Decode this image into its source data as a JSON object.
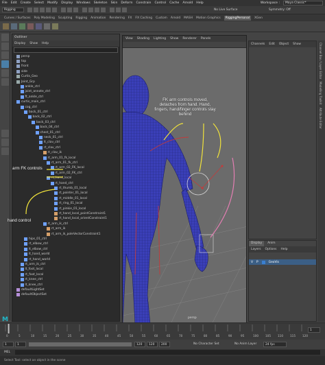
{
  "menubar": {
    "items": [
      "File",
      "Edit",
      "Create",
      "Select",
      "Modify",
      "Display",
      "Windows",
      "Skeleton",
      "Skin",
      "Deform",
      "Constrain",
      "Control",
      "Cache",
      "Arnold",
      "Help"
    ],
    "workspace_label": "Workspace :",
    "workspace_value": "Maya Classic*"
  },
  "statusline": {
    "mode": "Rigging",
    "live_surface": "No Live Surface",
    "symmetry": "Symmetry: Off"
  },
  "shelf": {
    "tabs": [
      "Curves / Surfaces",
      "Poly Modeling",
      "Sculpting",
      "Rigging",
      "Animation",
      "Rendering",
      "FX",
      "FX Caching",
      "Custom",
      "Arnold",
      "MASH",
      "Motion Graphics",
      "RiggingPersonal",
      "XGen"
    ],
    "active_tab": "RiggingPersonal"
  },
  "outliner": {
    "title": "Outliner",
    "menu": [
      "Display",
      "Show",
      "Help"
    ],
    "nodes": [
      {
        "label": "persp",
        "indent": 0,
        "type": "cam"
      },
      {
        "label": "top",
        "indent": 0,
        "type": "cam"
      },
      {
        "label": "front",
        "indent": 0,
        "type": "cam"
      },
      {
        "label": "side",
        "indent": 0,
        "type": "cam"
      },
      {
        "label": "Curtis_Geo",
        "indent": 0,
        "type": "grp"
      },
      {
        "label": "Joint_Grp",
        "indent": 0,
        "type": "grp"
      },
      {
        "label": "ankle_ctrl",
        "indent": 1,
        "type": "loc"
      },
      {
        "label": "joint_annote_ctrl",
        "indent": 1,
        "type": "loc"
      },
      {
        "label": "ft_ankle_ctrl",
        "indent": 1,
        "type": "loc"
      },
      {
        "label": "curtis_main_ctrl",
        "indent": 0,
        "type": "loc"
      },
      {
        "label": "cog_ctrl",
        "indent": 1,
        "type": "loc"
      },
      {
        "label": "back_01_ctrl",
        "indent": 2,
        "type": "loc"
      },
      {
        "label": "back_02_ctrl",
        "indent": 3,
        "type": "loc"
      },
      {
        "label": "back_03_ctrl",
        "indent": 4,
        "type": "loc"
      },
      {
        "label": "back_04_ctrl",
        "indent": 5,
        "type": "loc"
      },
      {
        "label": "chest_01_ctrl",
        "indent": 5,
        "type": "loc"
      },
      {
        "label": "neck_01_ctrl",
        "indent": 6,
        "type": "loc"
      },
      {
        "label": "lt_clav_ctrl",
        "indent": 6,
        "type": "loc"
      },
      {
        "label": "rt_clav_ctrl",
        "indent": 6,
        "type": "loc"
      },
      {
        "label": "rt_clav_ik",
        "indent": 7,
        "type": "joint"
      },
      {
        "label": "rt_arm_01_fk_local",
        "indent": 7,
        "type": "loc"
      },
      {
        "label": "rt_arm_01_fk_ctrl",
        "indent": 8,
        "type": "loc"
      },
      {
        "label": "rt_arm_02_FK_local",
        "indent": 9,
        "type": "loc"
      },
      {
        "label": "rt_arm_02_FK_ctrl",
        "indent": 9,
        "type": "loc"
      },
      {
        "label": "rt_hand_local",
        "indent": 8,
        "type": "loc"
      },
      {
        "label": "rt_hand_ctrl",
        "indent": 9,
        "type": "loc"
      },
      {
        "label": "rt_thumb_01_local",
        "indent": 10,
        "type": "loc"
      },
      {
        "label": "rt_pointer_01_local",
        "indent": 10,
        "type": "loc"
      },
      {
        "label": "rt_middle_01_local",
        "indent": 10,
        "type": "loc"
      },
      {
        "label": "rt_ring_01_local",
        "indent": 10,
        "type": "loc"
      },
      {
        "label": "rt_pinkie_01_local",
        "indent": 10,
        "type": "loc"
      },
      {
        "label": "rt_hand_local_pointConstraint1",
        "indent": 10,
        "type": "joint"
      },
      {
        "label": "rt_hand_local_orientConstraint1",
        "indent": 10,
        "type": "joint"
      },
      {
        "label": "rt_arm_ik_ctrl",
        "indent": 7,
        "type": "loc"
      },
      {
        "label": "rt_arm_ik",
        "indent": 8,
        "type": "joint"
      },
      {
        "label": "rt_arm_ik_poleVectorConstraint1",
        "indent": 8,
        "type": "joint"
      },
      {
        "label": "hips_01_ctrl",
        "indent": 2,
        "type": "loc"
      },
      {
        "label": "rt_elbow_ctrl",
        "indent": 2,
        "type": "loc"
      },
      {
        "label": "lt_elbow_ctrl",
        "indent": 2,
        "type": "loc"
      },
      {
        "label": "lt_hand_world",
        "indent": 2,
        "type": "loc"
      },
      {
        "label": "rt_hand_world",
        "indent": 2,
        "type": "loc"
      },
      {
        "label": "rt_arm_ik_ctrl",
        "indent": 1,
        "type": "loc"
      },
      {
        "label": "lt_foot_local",
        "indent": 1,
        "type": "loc"
      },
      {
        "label": "rt_foot_local",
        "indent": 1,
        "type": "loc"
      },
      {
        "label": "rt_knee_ctrl",
        "indent": 1,
        "type": "loc"
      },
      {
        "label": "lt_knee_ctrl",
        "indent": 1,
        "type": "loc"
      },
      {
        "label": "defaultLightSet",
        "indent": 0,
        "type": "set"
      },
      {
        "label": "defaultObjectSet",
        "indent": 0,
        "type": "set"
      }
    ]
  },
  "viewport": {
    "menu": [
      "View",
      "Shading",
      "Lighting",
      "Show",
      "Renderer",
      "Panels"
    ],
    "camera_label": "persp"
  },
  "channelbox": {
    "menu": [
      "Channels",
      "Edit",
      "Object",
      "Show"
    ]
  },
  "display_panel": {
    "tabs": [
      "Display",
      "Anim"
    ],
    "menu": [
      "Layers",
      "Options",
      "Help"
    ],
    "layer_v": "V",
    "layer_p": "P",
    "layer_name": "GeoVis"
  },
  "side_tabs": [
    "Channel Box / Layer Editor",
    "Modelling Toolkit",
    "Attribute Editor"
  ],
  "annotations": {
    "top": "FK arm controls moved, detaches from hand. Hand, fingers, hand/finger controls stay behind",
    "arm_fk": "arm FK controls",
    "hand": "hand control"
  },
  "timeline": {
    "ticks": [
      "0",
      "5",
      "10",
      "15",
      "20",
      "25",
      "30",
      "35",
      "40",
      "45",
      "50",
      "55",
      "60",
      "65",
      "70",
      "75",
      "80",
      "85",
      "90",
      "95",
      "100",
      "105",
      "110",
      "115",
      "120"
    ],
    "current_frame": "1"
  },
  "range": {
    "start": "1",
    "playback_start": "1",
    "playback_end": "120",
    "end": "120",
    "anim_end": "200",
    "character_set": "No Character Set",
    "anim_layer": "No Anim Layer",
    "fps": "24 fps"
  },
  "mel": {
    "label": "MEL"
  },
  "help_line": "Select Tool: select an object in the scene",
  "colors": {
    "annotation_arrow": "#f1e33b",
    "pink_arrow": "#e47fb3",
    "mesh_blue": "#2a2fa8",
    "ctrl_red": "#c43a3a",
    "active_tab": "#5a5a5a"
  }
}
